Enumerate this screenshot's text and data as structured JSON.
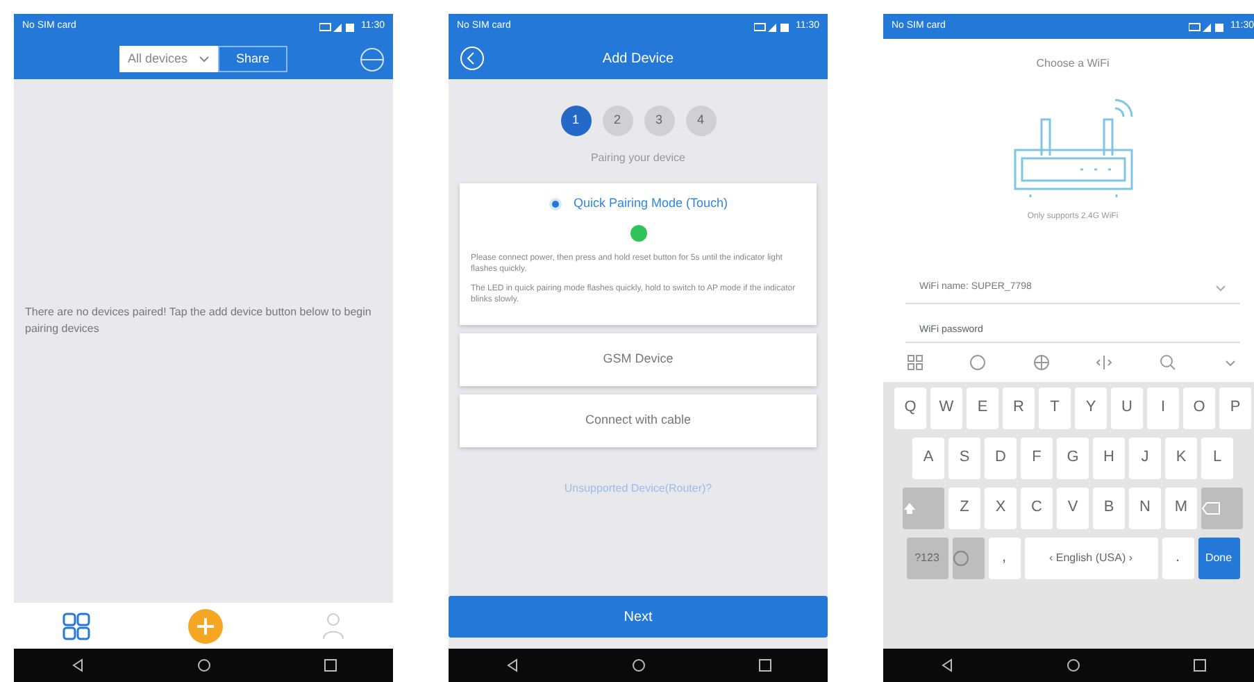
{
  "screens": [
    {
      "kind": "home",
      "status": {
        "carrier": "No SIM card",
        "time": "11:30"
      },
      "filter": {
        "value": "All devices"
      },
      "share_button": "Share",
      "empty_message": "There are no devices paired! Tap the add device button below to begin pairing devices",
      "tabs": [
        {
          "kind": "grid",
          "selected": true
        },
        {
          "kind": "add",
          "selected": false
        },
        {
          "kind": "person",
          "selected": false
        }
      ]
    },
    {
      "kind": "add_device",
      "status": {
        "carrier": "No SIM card",
        "time": "11:30"
      },
      "title": "Add Device",
      "steps": [
        {
          "label": "1",
          "selected": true
        },
        {
          "label": "2",
          "selected": false
        },
        {
          "label": "3",
          "selected": false
        },
        {
          "label": "4",
          "selected": false
        }
      ],
      "step_caption": "Pairing your device",
      "modes": [
        {
          "label": "Quick Pairing Mode",
          "hint": "(Touch)",
          "selected": true,
          "paragraphs": [
            "Please connect power, then press and hold reset button for 5s until the indicator light flashes quickly.",
            "The LED in quick pairing mode flashes quickly, hold to switch to AP mode if the indicator blinks slowly."
          ]
        },
        {
          "label": "GSM Device",
          "selected": false
        },
        {
          "label": "Connect with cable",
          "selected": false
        }
      ],
      "link": "Unsupported Device(Router)?",
      "next_button": "Next"
    },
    {
      "kind": "wifi",
      "status": {
        "carrier": "No SIM card",
        "time": "11:30"
      },
      "title": "Choose a WiFi",
      "caption": "Only supports 2.4G WiFi",
      "wifi_name": "WiFi name:  SUPER_7798",
      "password": {
        "placeholder": "WiFi password"
      },
      "keyboard": {
        "rows": [
          [
            "Q",
            "W",
            "E",
            "R",
            "T",
            "Y",
            "U",
            "I",
            "O",
            "P"
          ],
          [
            "A",
            "S",
            "D",
            "F",
            "G",
            "H",
            "J",
            "K",
            "L"
          ],
          [
            "Z",
            "X",
            "C",
            "V",
            "B",
            "N",
            "M"
          ]
        ],
        "symbols_key": "?123",
        "comma_key": ",",
        "space_key": "‹ English (USA) ›",
        "period_key": ".",
        "done_key": "Done"
      }
    }
  ]
}
